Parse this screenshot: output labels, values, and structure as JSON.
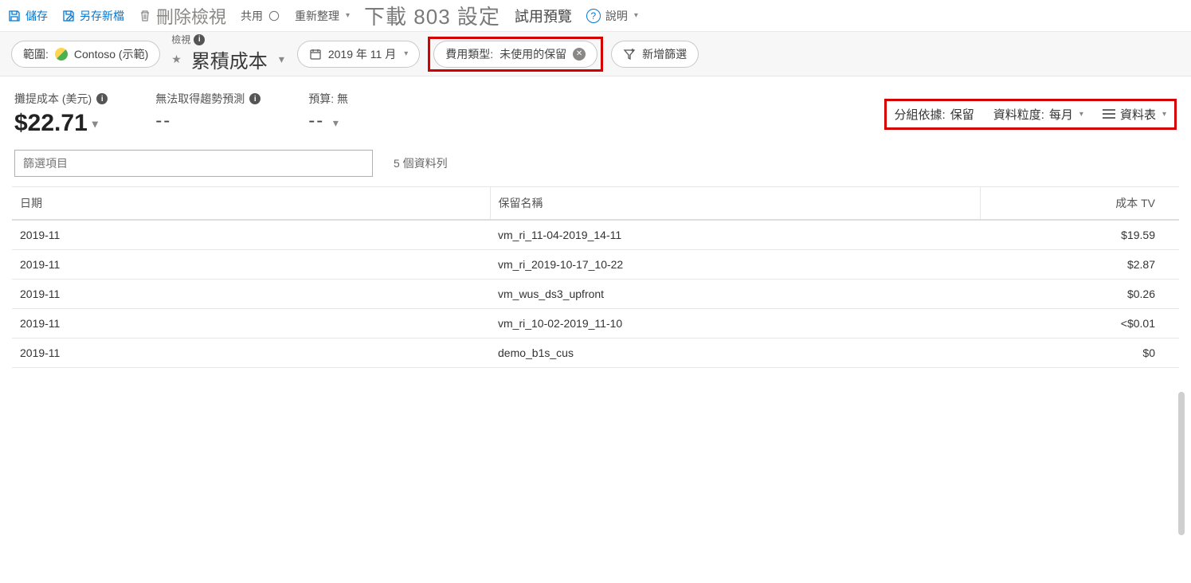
{
  "commands": {
    "save": "儲存",
    "save_as": "另存新檔",
    "delete_view": "刪除檢視",
    "share": "共用",
    "refresh": "重新整理",
    "download_settings": "下載 803 設定",
    "try_preview": "試用預覽",
    "help": "說明"
  },
  "filters": {
    "scope_label": "範圍:",
    "scope_value": "Contoso (示範)",
    "view_caption": "檢視",
    "view_value": "累積成本",
    "date_value": "2019 年 11 月",
    "charge_type_label": "費用類型:",
    "charge_type_value": "未使用的保留",
    "add_filter": "新增篩選"
  },
  "kpi": {
    "accrued_label": "攤提成本 (美元)",
    "accrued_value": "$22.71",
    "forecast_label": "無法取得趨勢預測",
    "forecast_value": "--",
    "budget_label": "預算: 無",
    "budget_value": "--"
  },
  "display": {
    "group_by_label": "分組依據:",
    "group_by_value": "保留",
    "granularity_label": "資料粒度:",
    "granularity_value": "每月",
    "view_mode": "資料表"
  },
  "search": {
    "placeholder": "篩選項目",
    "row_count": "5 個資料列"
  },
  "table": {
    "headers": {
      "date": "日期",
      "name": "保留名稱",
      "cost": "成本 TV"
    },
    "rows": [
      {
        "date": "2019-11",
        "name": "vm_ri_11-04-2019_14-11",
        "cost": "$19.59"
      },
      {
        "date": "2019-11",
        "name": "vm_ri_2019-10-17_10-22",
        "cost": "$2.87"
      },
      {
        "date": "2019-11",
        "name": "vm_wus_ds3_upfront",
        "cost": "$0.26"
      },
      {
        "date": "2019-11",
        "name": "vm_ri_10-02-2019_11-10",
        "cost": "<$0.01"
      },
      {
        "date": "2019-11",
        "name": "demo_b1s_cus",
        "cost": "$0"
      }
    ]
  }
}
